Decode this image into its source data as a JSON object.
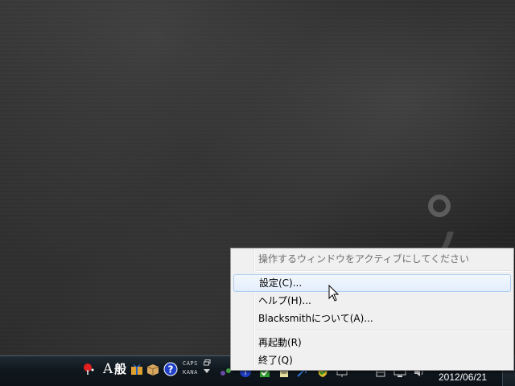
{
  "context_menu": {
    "items": [
      {
        "label": "操作するウィンドウをアクティブにしてください",
        "state": "disabled"
      },
      {
        "label": "設定(C)...",
        "state": "hovered"
      },
      {
        "label": "ヘルプ(H)...",
        "state": "normal"
      },
      {
        "label": "Blacksmithについて(A)...",
        "state": "normal"
      },
      {
        "label": "再起動(R)",
        "state": "normal"
      },
      {
        "label": "終了(Q)",
        "state": "normal"
      }
    ]
  },
  "taskbar": {
    "ime_mode": "A",
    "ime_conversion": "般",
    "caps_label": "CAPS",
    "kana_label": "KANA",
    "clock_date": "2012/06/21",
    "icons": [
      "pin-icon",
      "gift-icon",
      "package-icon",
      "help-icon",
      "restore-icon",
      "dropdown-icon"
    ]
  },
  "colors": {
    "menu_bg": "#f0f0f0",
    "menu_border": "#979797",
    "hover_bg": "#e3eefb",
    "hover_border": "#aeccf2",
    "disabled_text": "#6d6d6d",
    "taskbar": "#10181f",
    "desktop": "#2b2b2b"
  }
}
